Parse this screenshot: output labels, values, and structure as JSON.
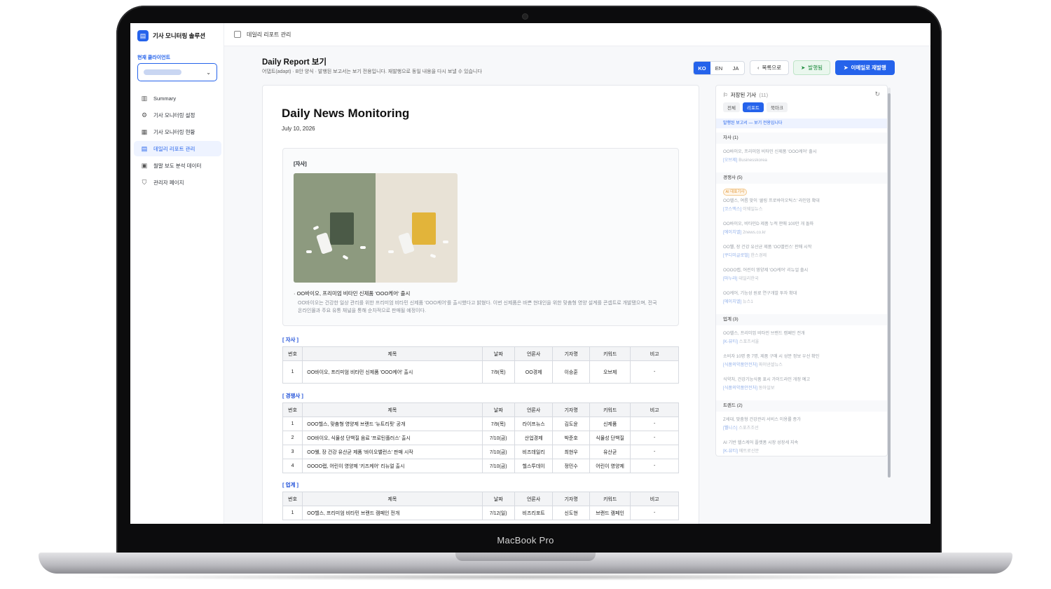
{
  "device": {
    "label": "MacBook Pro"
  },
  "sidebar": {
    "brand": "기사 모니터링 솔루션",
    "client_label": "현재 클라이언트",
    "items": [
      {
        "label": "Summary",
        "icon": "bar-chart-icon"
      },
      {
        "label": "기사 모니터링 설정",
        "icon": "gear-icon"
      },
      {
        "label": "기사 모니터링 현황",
        "icon": "newspaper-icon"
      },
      {
        "label": "데일리 리포트 관리",
        "icon": "document-icon",
        "active": true
      },
      {
        "label": "월말 보도 분석 데이터",
        "icon": "calendar-icon"
      },
      {
        "label": "관리자 페이지",
        "icon": "shield-icon"
      }
    ]
  },
  "topbar": {
    "breadcrumb": "데일리 리포트 관리"
  },
  "header": {
    "title": "Daily Report 보기",
    "desc": "어댑트(adapt) · B안 양식 · 발행된 보고서는 보기 전용입니다. 재발행으로 동일 내용을 다시 보낼 수 있습니다",
    "langs": [
      "KO",
      "EN",
      "JA"
    ],
    "active_lang": "KO",
    "back": "목록으로",
    "published": "발행됨",
    "resend": "이메일로 재발행"
  },
  "doc": {
    "title": "Daily News Monitoring",
    "date": "July 10, 2026",
    "feature": {
      "category": "[자사]",
      "headline": "· OO바이오, 프리미엄 비타민 신제품 'OOO케어' 출시",
      "body": "OO바이오는 건강한 일상 관리를 위한 프리미엄 비타민 신제품 'OOO케어'를 출시했다고 밝혔다. 이번 신제품은 바쁜 현대인을 위한 맞춤형 영양 설계를 콘셉트로 개발됐으며, 전국 온라인몰과 주요 유통 채널을 통해 순차적으로 판매될 예정이다."
    },
    "columns": [
      "번호",
      "제목",
      "날짜",
      "언론사",
      "기자명",
      "키워드",
      "비고"
    ],
    "sections": [
      {
        "name": "[ 자사 ]",
        "rows": [
          [
            "1",
            "OO바이오, 프리미엄 비타민 신제품 'OOO케어' 출시",
            "7/9(목)",
            "OO경제",
            "이승훈",
            "오브제",
            "-"
          ]
        ]
      },
      {
        "name": "[ 경쟁사 ]",
        "rows": [
          [
            "1",
            "OOO헬스, 맞춤형 영양제 브랜드 '뉴트리핏' 공개",
            "7/9(목)",
            "라이프뉴스",
            "김도윤",
            "신제품",
            "-"
          ],
          [
            "2",
            "OO바이오, 식물성 단백질 음료 '프로틴플러스' 출시",
            "7/10(금)",
            "산업경제",
            "박준호",
            "식물성 단백질",
            "-"
          ],
          [
            "3",
            "OO웰, 장 건강 유산균 제품 '바이오밸런스' 판매 시작",
            "7/10(금)",
            "비즈데일리",
            "최현우",
            "유산균",
            "-"
          ],
          [
            "4",
            "OOOO랩, 어린이 영양제 '키즈케어' 리뉴얼 출시",
            "7/10(금)",
            "헬스투데이",
            "정민수",
            "어린이 영양제",
            "-"
          ]
        ]
      },
      {
        "name": "[ 업계 ]",
        "rows": [
          [
            "1",
            "OO헬스, 프리미엄 비타민 브랜드 캠페인 전개",
            "7/12(일)",
            "비즈리포트",
            "신도현",
            "브랜드 캠페인",
            "-"
          ]
        ]
      }
    ]
  },
  "panel": {
    "title": "저장된 기사",
    "count": "(11)",
    "tabs": [
      "전체",
      "리포트",
      "북마크"
    ],
    "active_tab": "리포트",
    "notice": "발행된 보고서 — 보기 전용입니다",
    "ai_badge": "AI 대표기사",
    "groups": [
      {
        "name": "자사 (1)",
        "items": [
          {
            "title": "OO바이오, 프리미엄 비타민 신제품 'OOO케어' 출시",
            "tag": "[오브제]",
            "source": "Businesskorea"
          }
        ]
      },
      {
        "name": "경쟁사 (5)",
        "items": [
          {
            "title": "OO헬스, 여름 맞이 '쿨링 프로바이오틱스' 라인업 확대",
            "tag": "[코스맥스]",
            "source": "이웨일뉴스"
          },
          {
            "title": "OO바이오, 비타민D 제품 누적 판매 100만 개 돌파",
            "tag": "[에이치엘]",
            "source": "2news.co.kr"
          },
          {
            "title": "OO웰, 장 건강 유산균 제품 'OO밸런스' 판매 시작",
            "tag": "[쿠디미글로벌]",
            "source": "한스경제"
          },
          {
            "title": "OOOO랩, 어린이 영양제 'OO케어' 리뉴얼 출시",
            "tag": "[마누라]",
            "source": "데일리한국"
          },
          {
            "title": "OO케어, 기능성 원료 연구개발 투자 확대",
            "tag": "[에이치엘]",
            "source": "뉴스1"
          }
        ]
      },
      {
        "name": "업계 (3)",
        "items": [
          {
            "title": "OO헬스, 프리미엄 비타민 브랜드 캠페인 전개",
            "tag": "[K-뷰티]",
            "source": "스포츠서울"
          },
          {
            "title": "소비자 10명 중 7명, 제품 구매 시 성분 정보 우선 확인",
            "tag": "[식품의약품안전처]",
            "source": "파이낸셜뉴스"
          },
          {
            "title": "식약처, 건강기능식품 표시 가이드라인 개정 예고",
            "tag": "[식품의약품안전처]",
            "source": "동아일보"
          }
        ]
      },
      {
        "name": "트렌드 (2)",
        "items": [
          {
            "title": "Z세대, 맞춤형 건강관리 서비스 이용률 증가",
            "tag": "[웰니스]",
            "source": "스포츠조선"
          },
          {
            "title": "AI 기반 헬스케어 플랫폼 시장 성장세 지속",
            "tag": "[K-뷰티]",
            "source": "메트로신문"
          }
        ]
      }
    ]
  }
}
